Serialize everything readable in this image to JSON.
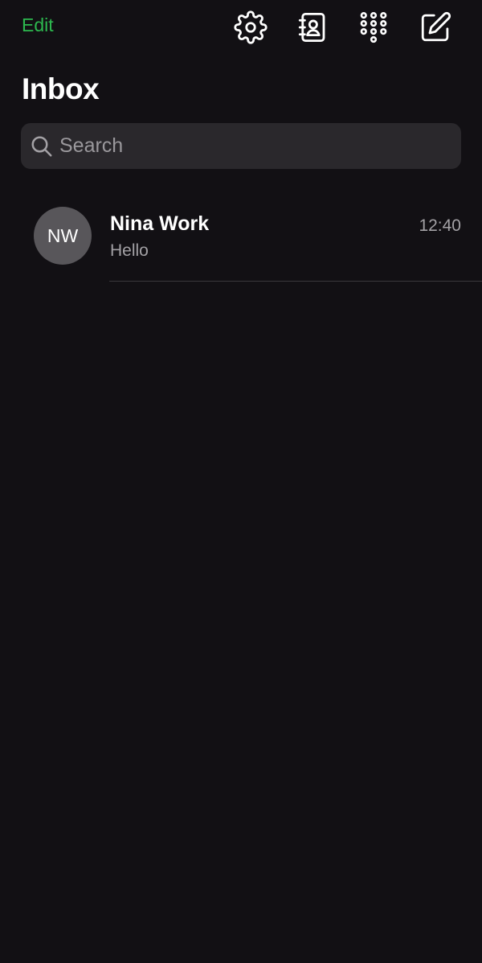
{
  "toolbar": {
    "edit_label": "Edit",
    "icons": [
      "gear-icon",
      "contacts-book-icon",
      "dialpad-icon",
      "compose-icon"
    ]
  },
  "header": {
    "title": "Inbox"
  },
  "search": {
    "placeholder": "Search",
    "value": ""
  },
  "conversations": [
    {
      "initials": "NW",
      "name": "Nina Work",
      "preview": "Hello",
      "time": "12:40"
    }
  ],
  "colors": {
    "background": "#121014",
    "accent": "#2db84f",
    "search_bg": "#2a282c",
    "avatar_bg": "#58565a",
    "secondary_text": "#a3a1a5"
  }
}
